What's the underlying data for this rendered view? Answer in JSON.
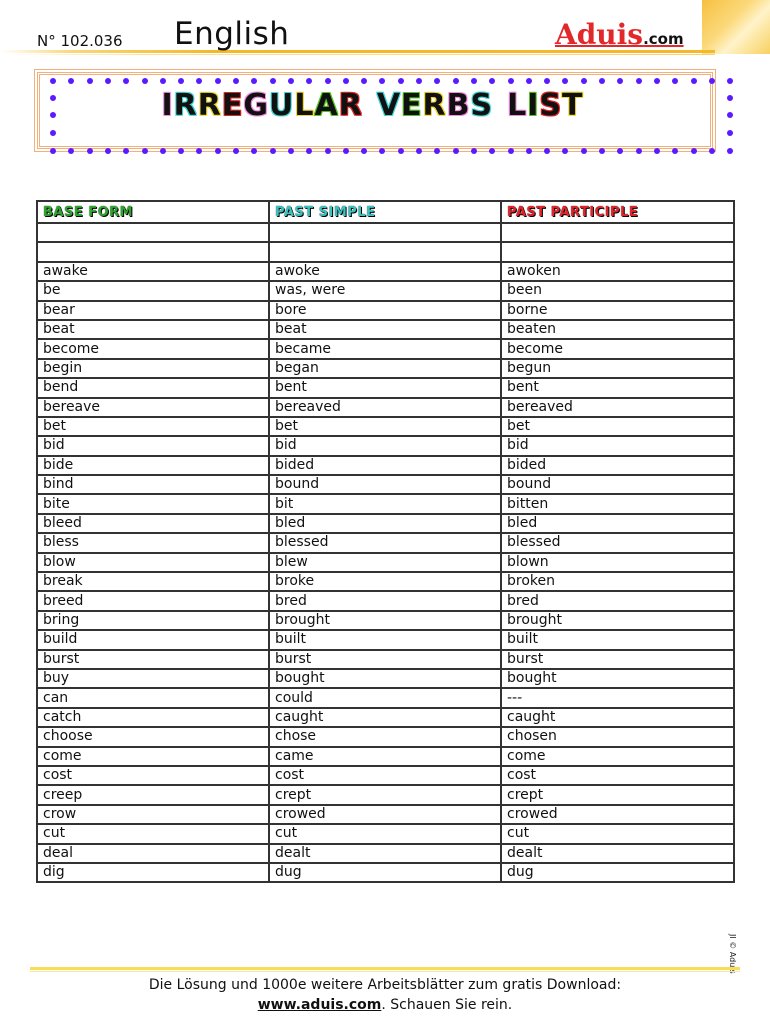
{
  "header": {
    "number": "N° 102.036",
    "subject": "English",
    "logo_main": "Aduis",
    "logo_suffix": ".com"
  },
  "title": {
    "letters": [
      {
        "ch": "I",
        "color": "#f28ae0"
      },
      {
        "ch": "R",
        "color": "#3cd6d6"
      },
      {
        "ch": "R",
        "color": "#f0d52a"
      },
      {
        "ch": "E",
        "color": "#e52222"
      },
      {
        "ch": "G",
        "color": "#f28ae0"
      },
      {
        "ch": "U",
        "color": "#3cd6d6"
      },
      {
        "ch": "L",
        "color": "#f0d52a"
      },
      {
        "ch": "A",
        "color": "#55c41e"
      },
      {
        "ch": "R",
        "color": "#e52222"
      },
      {
        "ch": " ",
        "color": "#ffffff"
      },
      {
        "ch": "V",
        "color": "#3cd6d6"
      },
      {
        "ch": "E",
        "color": "#55c41e"
      },
      {
        "ch": "R",
        "color": "#f0d52a"
      },
      {
        "ch": "B",
        "color": "#f28ae0"
      },
      {
        "ch": "S",
        "color": "#3cd6d6"
      },
      {
        "ch": " ",
        "color": "#ffffff"
      },
      {
        "ch": "L",
        "color": "#f28ae0"
      },
      {
        "ch": "I",
        "color": "#55c41e"
      },
      {
        "ch": "S",
        "color": "#e52222"
      },
      {
        "ch": "T",
        "color": "#f0d52a"
      }
    ],
    "text": "IRREGULAR VERBS LIST"
  },
  "table": {
    "headers": [
      "BASE FORM",
      "PAST SIMPLE",
      "PAST PARTICIPLE"
    ],
    "rows": [
      [
        "",
        "",
        ""
      ],
      [
        "",
        "",
        ""
      ],
      [
        "awake",
        "awoke",
        "awoken"
      ],
      [
        "be",
        "was, were",
        "been"
      ],
      [
        "bear",
        "bore",
        "borne"
      ],
      [
        "beat",
        "beat",
        "beaten"
      ],
      [
        "become",
        "became",
        "become"
      ],
      [
        "begin",
        "began",
        "begun"
      ],
      [
        "bend",
        "bent",
        "bent"
      ],
      [
        "bereave",
        "bereaved",
        "bereaved"
      ],
      [
        "bet",
        "bet",
        "bet"
      ],
      [
        "bid",
        "bid",
        "bid"
      ],
      [
        "bide",
        "bided",
        "bided"
      ],
      [
        "bind",
        "bound",
        "bound"
      ],
      [
        "bite",
        "bit",
        "bitten"
      ],
      [
        "bleed",
        "bled",
        "bled"
      ],
      [
        "bless",
        "blessed",
        "blessed"
      ],
      [
        "blow",
        "blew",
        "blown"
      ],
      [
        "break",
        "broke",
        "broken"
      ],
      [
        "breed",
        "bred",
        "bred"
      ],
      [
        "bring",
        "brought",
        "brought"
      ],
      [
        "build",
        "built",
        "built"
      ],
      [
        "burst",
        "burst",
        "burst"
      ],
      [
        "buy",
        "bought",
        "bought"
      ],
      [
        "can",
        "could",
        "---"
      ],
      [
        "catch",
        "caught",
        "caught"
      ],
      [
        "choose",
        "chose",
        "chosen"
      ],
      [
        "come",
        "came",
        "come"
      ],
      [
        "cost",
        "cost",
        "cost"
      ],
      [
        "creep",
        "crept",
        "crept"
      ],
      [
        "crow",
        "crowed",
        "crowed"
      ],
      [
        "cut",
        "cut",
        "cut"
      ],
      [
        "deal",
        "dealt",
        "dealt"
      ],
      [
        "dig",
        "dug",
        "dug"
      ]
    ]
  },
  "side_note": "JI © Aduis",
  "footer": {
    "line1": "Die Lösung und 1000e weitere Arbeitsblätter zum gratis Download:",
    "link": "www.aduis.com",
    "line2_rest": ". Schauen Sie rein."
  },
  "colors": {
    "dot": "#5b1bff",
    "frame": "#f3b07a",
    "header_rule": "#f5b826",
    "footer_rule": "#f7dd5c",
    "logo": "#e1282a"
  }
}
